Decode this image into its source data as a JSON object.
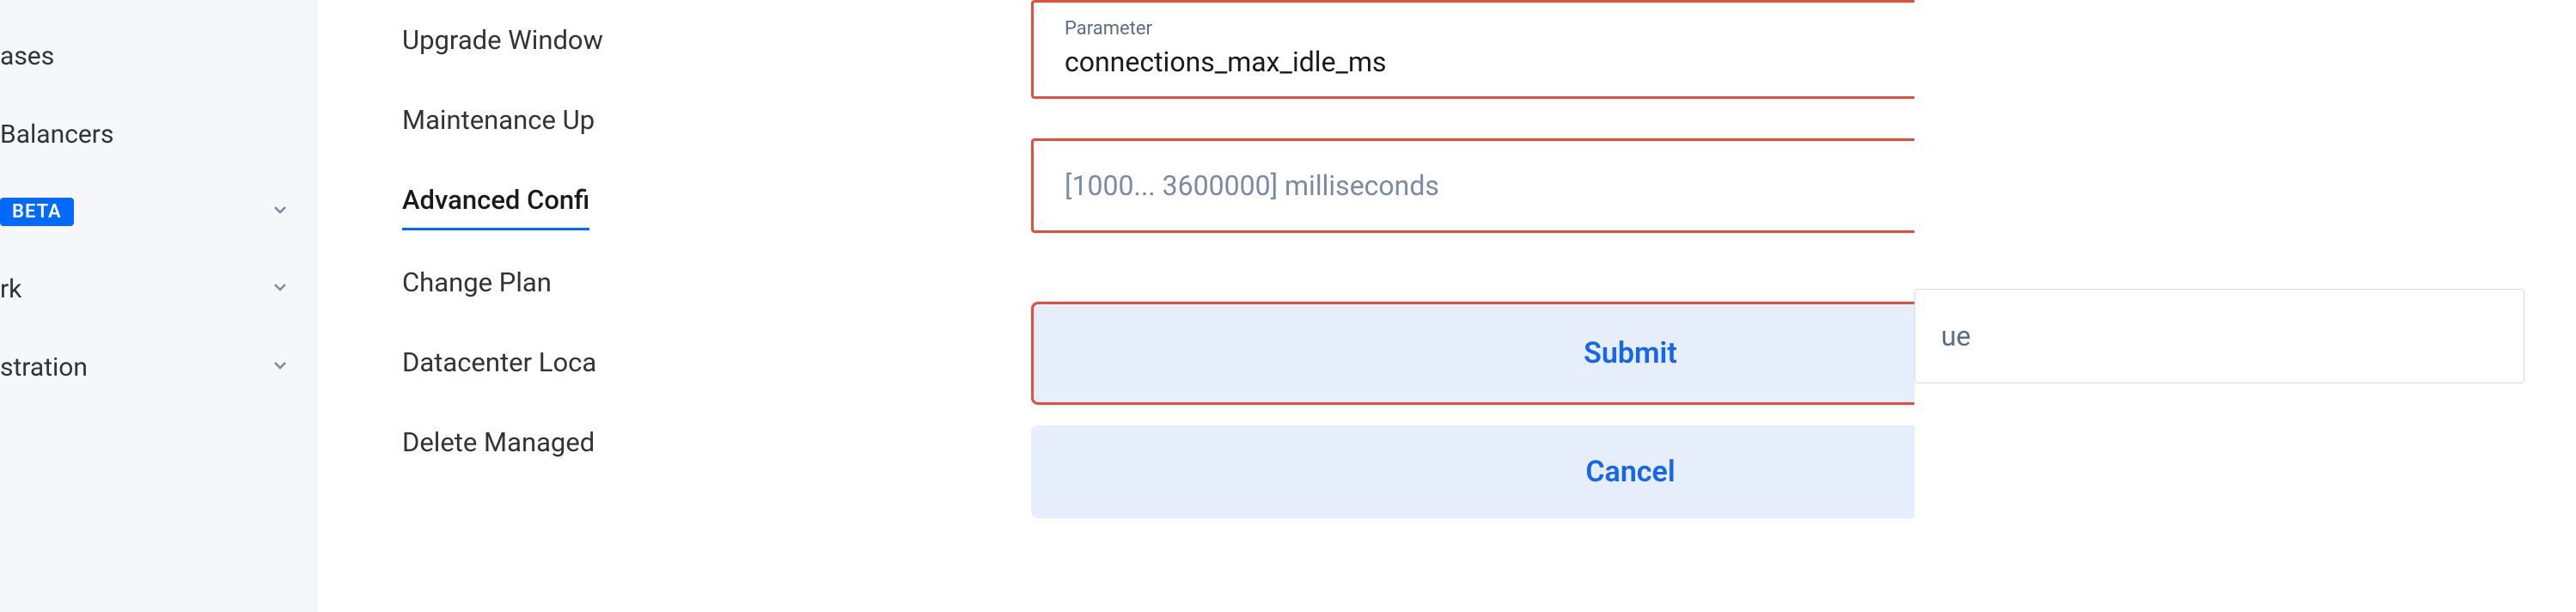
{
  "sidebar": {
    "items": [
      {
        "label": "ases"
      },
      {
        "label": "Balancers"
      },
      {
        "label": "",
        "badge": "BETA",
        "expandable": true
      },
      {
        "label": "rk",
        "expandable": true
      },
      {
        "label": "stration",
        "expandable": true
      }
    ]
  },
  "secondary_nav": {
    "items": [
      {
        "label": "Upgrade Window"
      },
      {
        "label": "Maintenance Up"
      },
      {
        "label": "Advanced Confi",
        "active": true
      },
      {
        "label": "Change Plan"
      },
      {
        "label": "Datacenter Loca"
      },
      {
        "label": "Delete Managed"
      }
    ]
  },
  "modal": {
    "parameter_label": "Parameter",
    "parameter_value": "connections_max_idle_ms",
    "value_placeholder": "[1000... 3600000] milliseconds",
    "submit_label": "Submit",
    "cancel_label": "Cancel"
  },
  "right_panel": {
    "partial_text": "ue"
  }
}
